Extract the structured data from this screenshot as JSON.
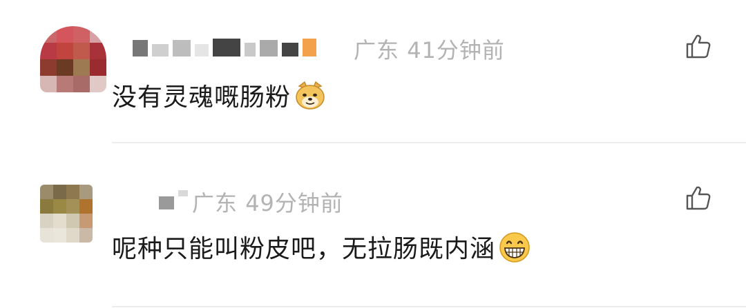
{
  "comments": [
    {
      "location": "广东",
      "time": "41分钟前",
      "text": "没有灵魂嘅肠粉",
      "emoji": "doge-emoji"
    },
    {
      "location": "广东",
      "time": "49分钟前",
      "text": "呢种只能叫粉皮吧，无拉肠既内涵",
      "emoji": "grin-emoji"
    }
  ],
  "icons": {
    "like": "thumbs-up-icon"
  },
  "colors": {
    "meta": "#b3b3b3",
    "text": "#1a1a1a",
    "divider": "#ececec"
  }
}
